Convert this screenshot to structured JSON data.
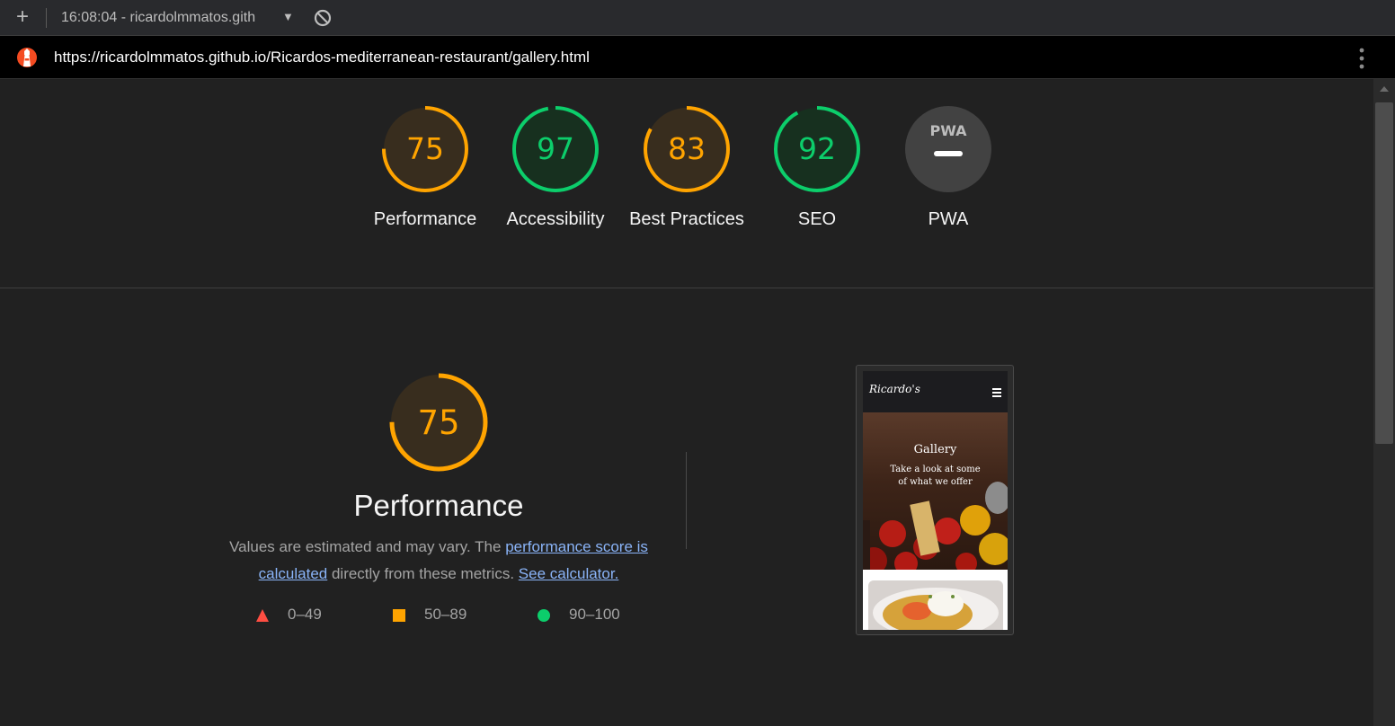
{
  "topbar": {
    "new_tab_icon": "plus-icon",
    "report_title": "16:08:04 - ricardolmmatos.gith",
    "dropdown_icon": "caret-down-icon",
    "clear_icon": "block-icon"
  },
  "urlbar": {
    "url": "https://ricardolmmatos.github.io/Ricardos-mediterranean-restaurant/gallery.html",
    "logo_icon": "lighthouse-icon",
    "menu_icon": "kebab-menu-icon"
  },
  "colors": {
    "average": "#ffa400",
    "pass": "#0cce6b",
    "fail": "#ff4e42",
    "pwa_gray": "#757575"
  },
  "scores": [
    {
      "label": "Performance",
      "value": "75",
      "score": 0.75,
      "status": "average"
    },
    {
      "label": "Accessibility",
      "value": "97",
      "score": 0.97,
      "status": "pass"
    },
    {
      "label": "Best Practices",
      "value": "83",
      "score": 0.83,
      "status": "average"
    },
    {
      "label": "SEO",
      "value": "92",
      "score": 0.92,
      "status": "pass"
    },
    {
      "label": "PWA",
      "value": "",
      "badge": "PWA",
      "status": "na"
    }
  ],
  "performance": {
    "score": "75",
    "title": "Performance",
    "desc_prefix": "Values are estimated and may vary. The ",
    "desc_link": "performance score is calculated",
    "desc_middle": " directly from these metrics. ",
    "calc_link": "See calculator.",
    "legend": [
      {
        "range": "0–49",
        "shape": "triangle",
        "status": "fail"
      },
      {
        "range": "50–89",
        "shape": "square",
        "status": "average"
      },
      {
        "range": "90–100",
        "shape": "circle",
        "status": "pass"
      }
    ]
  },
  "screenshot": {
    "brand": "Ricardo's",
    "hero_title": "Gallery",
    "hero_subtitle": "Take a look at some of what we offer"
  }
}
